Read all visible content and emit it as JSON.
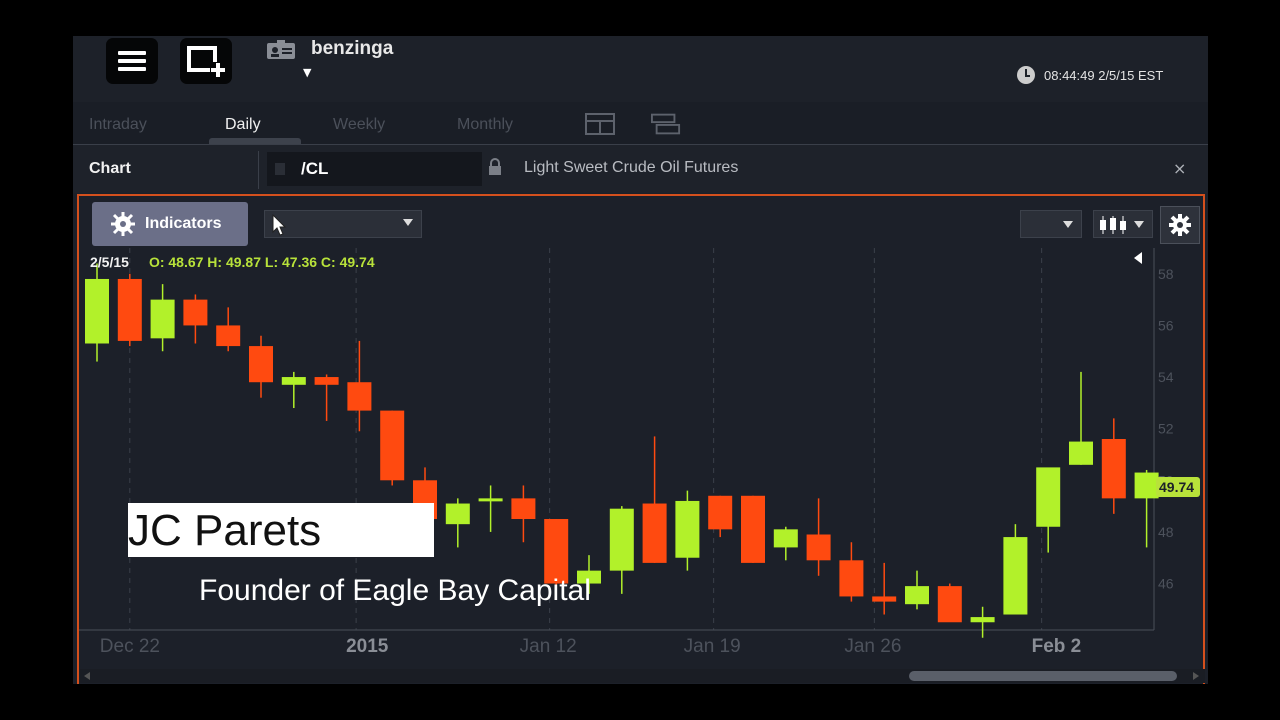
{
  "header": {
    "user": "benzinga",
    "time": "08:44:49 2/5/15 EST"
  },
  "tabs": [
    {
      "label": "Intraday",
      "active": false
    },
    {
      "label": "Daily",
      "active": true
    },
    {
      "label": "Weekly",
      "active": false
    },
    {
      "label": "Monthly",
      "active": false
    }
  ],
  "symbol_bar": {
    "label": "Chart",
    "symbol": "/CL",
    "description": "Light Sweet Crude Oil Futures",
    "close": "×"
  },
  "toolbar": {
    "indicators_label": "Indicators"
  },
  "ohlc": {
    "date": "2/5/15",
    "values": "O: 48.67 H: 49.87 L: 47.36 C: 49.74"
  },
  "overlay": {
    "name": "JC Parets",
    "title": "Founder of Eagle Bay Capital"
  },
  "colors": {
    "up": "#b2f12a",
    "down": "#ff4a10",
    "accent": "#d4501d"
  },
  "chart_data": {
    "type": "candlestick",
    "ylim": [
      44.2,
      59
    ],
    "y_ticks": [
      46,
      48,
      50,
      52,
      54,
      56,
      58
    ],
    "last_price_label": "49.74",
    "x_labels": [
      {
        "label": "Dec 22",
        "bold": false
      },
      {
        "label": "2015",
        "bold": true
      },
      {
        "label": "Jan 12",
        "bold": false
      },
      {
        "label": "Jan 19",
        "bold": false
      },
      {
        "label": "Jan 26",
        "bold": false
      },
      {
        "label": "Feb 2",
        "bold": true
      }
    ],
    "candles": [
      {
        "o": 55.3,
        "h": 58.4,
        "l": 54.6,
        "c": 57.8
      },
      {
        "o": 57.8,
        "h": 58.0,
        "l": 55.2,
        "c": 55.4
      },
      {
        "o": 55.5,
        "h": 57.6,
        "l": 55.0,
        "c": 57.0
      },
      {
        "o": 57.0,
        "h": 57.2,
        "l": 55.3,
        "c": 56.0
      },
      {
        "o": 56.0,
        "h": 56.7,
        "l": 55.0,
        "c": 55.2
      },
      {
        "o": 55.2,
        "h": 55.6,
        "l": 53.2,
        "c": 53.8
      },
      {
        "o": 53.7,
        "h": 54.2,
        "l": 52.8,
        "c": 54.0
      },
      {
        "o": 54.0,
        "h": 54.1,
        "l": 52.3,
        "c": 53.7
      },
      {
        "o": 53.8,
        "h": 55.4,
        "l": 51.9,
        "c": 52.7
      },
      {
        "o": 52.7,
        "h": 52.7,
        "l": 49.8,
        "c": 50.0
      },
      {
        "o": 50.0,
        "h": 50.5,
        "l": 48.3,
        "c": 48.5
      },
      {
        "o": 48.3,
        "h": 49.3,
        "l": 47.4,
        "c": 49.1
      },
      {
        "o": 49.2,
        "h": 49.8,
        "l": 48.0,
        "c": 49.3
      },
      {
        "o": 49.3,
        "h": 49.8,
        "l": 47.6,
        "c": 48.5
      },
      {
        "o": 48.5,
        "h": 48.5,
        "l": 45.8,
        "c": 46.0
      },
      {
        "o": 46.0,
        "h": 47.1,
        "l": 45.6,
        "c": 46.5
      },
      {
        "o": 46.5,
        "h": 49.0,
        "l": 45.6,
        "c": 48.9
      },
      {
        "o": 49.1,
        "h": 51.7,
        "l": 46.8,
        "c": 46.8
      },
      {
        "o": 47.0,
        "h": 49.6,
        "l": 46.5,
        "c": 49.2
      },
      {
        "o": 49.4,
        "h": 49.4,
        "l": 47.8,
        "c": 48.1
      },
      {
        "o": 49.4,
        "h": 49.4,
        "l": 46.8,
        "c": 46.8
      },
      {
        "o": 47.4,
        "h": 48.2,
        "l": 46.9,
        "c": 48.1
      },
      {
        "o": 47.9,
        "h": 49.3,
        "l": 46.3,
        "c": 46.9
      },
      {
        "o": 46.9,
        "h": 47.6,
        "l": 45.3,
        "c": 45.5
      },
      {
        "o": 45.5,
        "h": 46.8,
        "l": 44.8,
        "c": 45.3
      },
      {
        "o": 45.2,
        "h": 46.5,
        "l": 45.0,
        "c": 45.9
      },
      {
        "o": 45.9,
        "h": 46.0,
        "l": 44.7,
        "c": 44.5
      },
      {
        "o": 44.5,
        "h": 45.1,
        "l": 43.9,
        "c": 44.7
      },
      {
        "o": 44.8,
        "h": 48.3,
        "l": 44.8,
        "c": 47.8
      },
      {
        "o": 48.2,
        "h": 50.3,
        "l": 47.2,
        "c": 50.5
      },
      {
        "o": 50.6,
        "h": 54.2,
        "l": 50.6,
        "c": 51.5
      },
      {
        "o": 51.6,
        "h": 52.4,
        "l": 48.7,
        "c": 49.3
      },
      {
        "o": 49.3,
        "h": 50.4,
        "l": 47.4,
        "c": 50.3
      }
    ]
  }
}
